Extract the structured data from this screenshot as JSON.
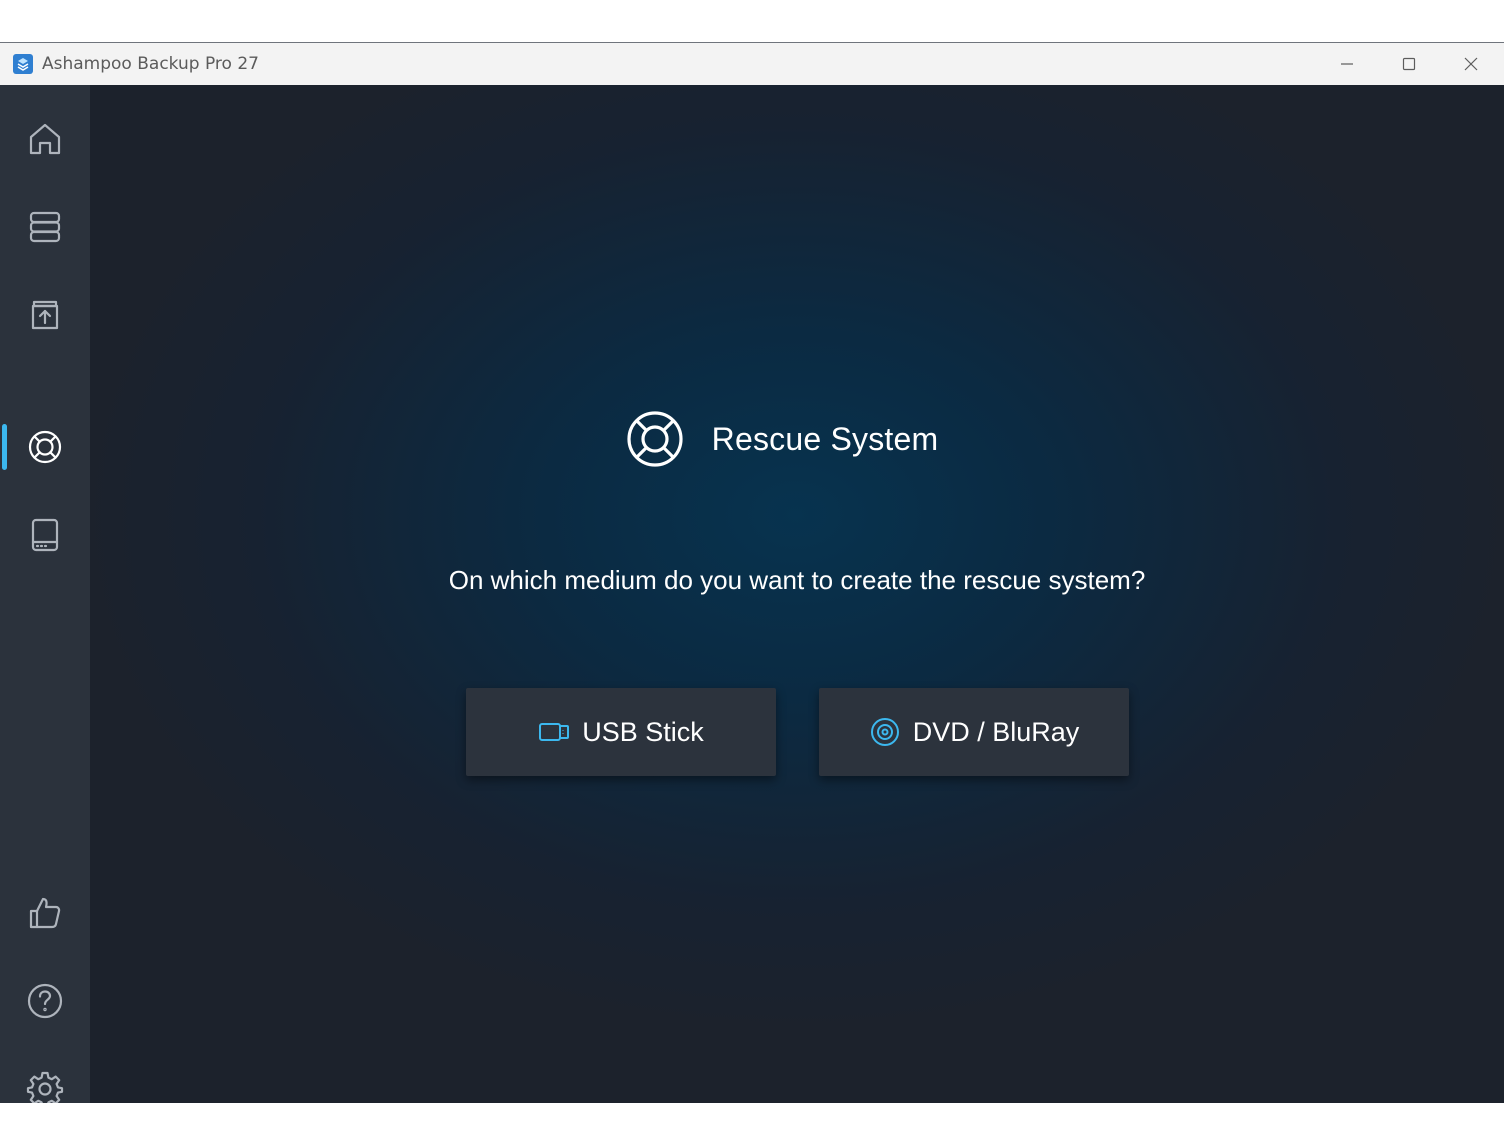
{
  "window": {
    "title": "Ashampoo Backup Pro 27"
  },
  "sidebar": {
    "items": [
      {
        "icon": "home-icon"
      },
      {
        "icon": "backups-stack-icon"
      },
      {
        "icon": "restore-archive-icon"
      },
      {
        "icon": "lifebuoy-icon",
        "active": true
      },
      {
        "icon": "drive-icon"
      }
    ],
    "bottom_items": [
      {
        "icon": "thumbs-up-icon"
      },
      {
        "icon": "help-icon"
      },
      {
        "icon": "gear-icon"
      }
    ]
  },
  "main": {
    "heading": "Rescue System",
    "question": "On which medium do you want to create the rescue system?",
    "buttons": {
      "usb_label": "USB Stick",
      "dvd_label": "DVD / BluRay"
    }
  },
  "colors": {
    "accent": "#3cb8ef",
    "sidebar_bg": "#2b323c",
    "button_bg": "#2c333d",
    "titlebar_bg": "#f3f3f3"
  }
}
